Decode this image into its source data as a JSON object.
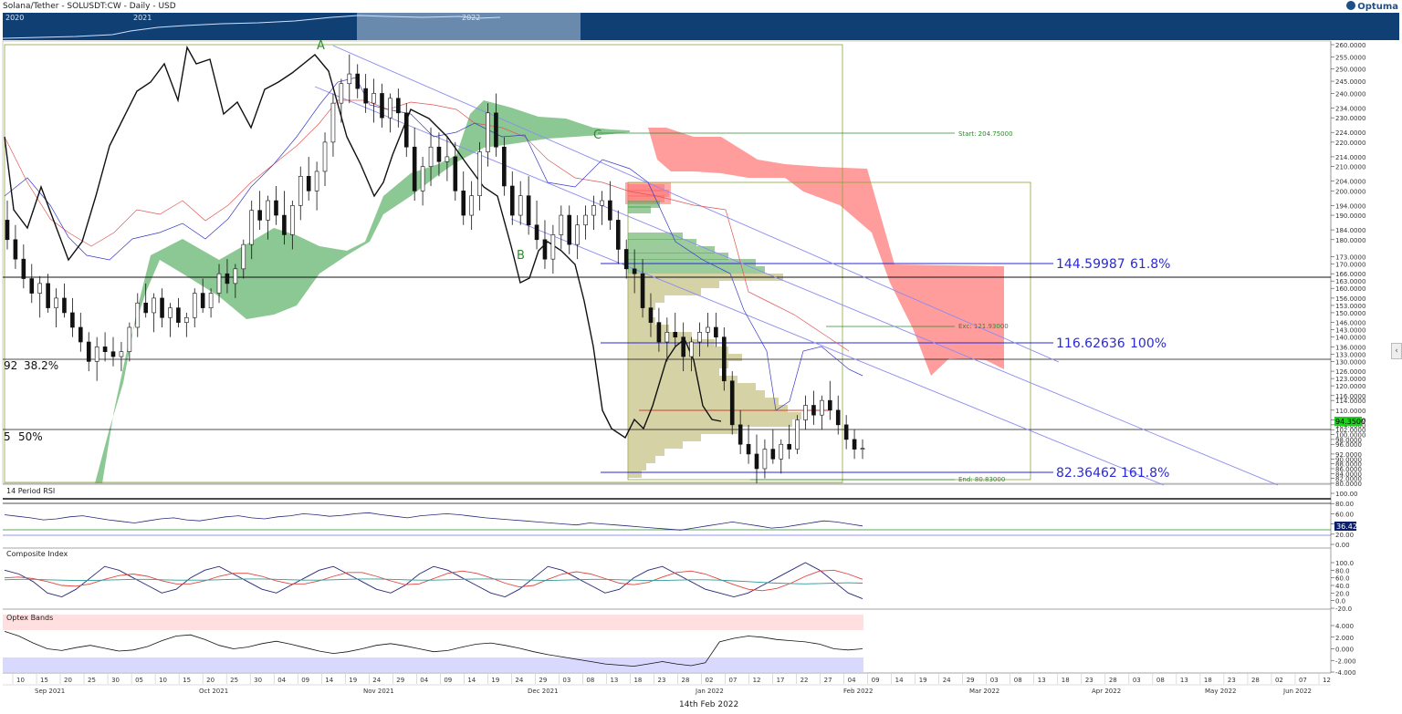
{
  "header": {
    "title": "Solana/Tether - SOLUSDT:CW - Daily - USD",
    "brand": "Optuma"
  },
  "navigator": {
    "years": [
      "2020",
      "2021",
      "2022"
    ]
  },
  "chart_data": [
    {
      "type": "candlestick",
      "title": "Solana/Tether - SOLUSDT:CW - Daily - USD",
      "ylim": [
        80,
        260
      ],
      "price_ticks": [
        260,
        255,
        250,
        245,
        240,
        234,
        230,
        224,
        220,
        214,
        210,
        204,
        200,
        194,
        190,
        184,
        180,
        173,
        170,
        166,
        163,
        160,
        156,
        153,
        150,
        146,
        143,
        140,
        136,
        133,
        130,
        126,
        123,
        120,
        116,
        114,
        110,
        106,
        104,
        102,
        100,
        98,
        96,
        92,
        90,
        88,
        86,
        84,
        82,
        80
      ],
      "last_price": "94.3500",
      "pivot_labels": [
        "A",
        "B",
        "C"
      ],
      "fib_levels": [
        {
          "price": "144.59987",
          "ratio": "61.8%"
        },
        {
          "price": "116.62636",
          "ratio": "100%"
        },
        {
          "price": "82.36462",
          "ratio": "161.8%"
        }
      ],
      "partial_levels": [
        {
          "price": "92",
          "ratio": "38.2%"
        },
        {
          "price": "5",
          "ratio": "50%"
        }
      ],
      "annotations": {
        "start": "Start: 204.75000",
        "exc": "Exc: 121.93000",
        "end": "End: 80.83000"
      },
      "candles": [
        [
          188,
          196,
          176,
          180
        ],
        [
          180,
          186,
          168,
          172
        ],
        [
          172,
          178,
          160,
          164
        ],
        [
          164,
          170,
          154,
          158
        ],
        [
          158,
          165,
          148,
          162
        ],
        [
          162,
          166,
          150,
          152
        ],
        [
          152,
          160,
          144,
          156
        ],
        [
          156,
          162,
          148,
          150
        ],
        [
          150,
          156,
          140,
          144
        ],
        [
          144,
          150,
          134,
          138
        ],
        [
          138,
          142,
          126,
          130
        ],
        [
          130,
          140,
          122,
          136
        ],
        [
          136,
          142,
          130,
          134
        ],
        [
          134,
          140,
          128,
          132
        ],
        [
          132,
          138,
          126,
          134
        ],
        [
          134,
          146,
          130,
          144
        ],
        [
          144,
          158,
          140,
          154
        ],
        [
          154,
          162,
          148,
          150
        ],
        [
          150,
          158,
          142,
          156
        ],
        [
          156,
          160,
          144,
          148
        ],
        [
          148,
          154,
          140,
          152
        ],
        [
          152,
          156,
          144,
          146
        ],
        [
          146,
          150,
          140,
          148
        ],
        [
          148,
          160,
          144,
          158
        ],
        [
          158,
          164,
          150,
          152
        ],
        [
          152,
          160,
          148,
          158
        ],
        [
          158,
          170,
          154,
          166
        ],
        [
          166,
          172,
          158,
          162
        ],
        [
          162,
          170,
          156,
          168
        ],
        [
          168,
          180,
          164,
          178
        ],
        [
          178,
          196,
          172,
          192
        ],
        [
          192,
          200,
          184,
          188
        ],
        [
          188,
          198,
          180,
          196
        ],
        [
          196,
          202,
          186,
          190
        ],
        [
          190,
          200,
          178,
          182
        ],
        [
          182,
          196,
          176,
          194
        ],
        [
          194,
          210,
          188,
          206
        ],
        [
          206,
          214,
          196,
          200
        ],
        [
          200,
          212,
          192,
          208
        ],
        [
          208,
          224,
          202,
          220
        ],
        [
          220,
          240,
          214,
          236
        ],
        [
          236,
          246,
          228,
          244
        ],
        [
          244,
          256,
          236,
          248
        ],
        [
          248,
          252,
          238,
          242
        ],
        [
          242,
          248,
          232,
          236
        ],
        [
          236,
          246,
          228,
          240
        ],
        [
          240,
          244,
          226,
          230
        ],
        [
          230,
          240,
          224,
          238
        ],
        [
          238,
          242,
          226,
          232
        ],
        [
          232,
          236,
          214,
          218
        ],
        [
          218,
          226,
          196,
          200
        ],
        [
          200,
          214,
          194,
          210
        ],
        [
          210,
          226,
          202,
          218
        ],
        [
          218,
          224,
          206,
          212
        ],
        [
          212,
          222,
          204,
          214
        ],
        [
          214,
          220,
          196,
          200
        ],
        [
          200,
          208,
          186,
          190
        ],
        [
          190,
          204,
          184,
          198
        ],
        [
          198,
          220,
          192,
          216
        ],
        [
          216,
          236,
          210,
          232
        ],
        [
          232,
          240,
          214,
          218
        ],
        [
          218,
          222,
          198,
          202
        ],
        [
          202,
          208,
          186,
          190
        ],
        [
          190,
          204,
          186,
          198
        ],
        [
          198,
          206,
          182,
          186
        ],
        [
          186,
          196,
          176,
          180
        ],
        [
          180,
          188,
          168,
          172
        ],
        [
          172,
          186,
          166,
          182
        ],
        [
          182,
          194,
          176,
          190
        ],
        [
          190,
          194,
          174,
          178
        ],
        [
          178,
          190,
          172,
          186
        ],
        [
          186,
          194,
          180,
          190
        ],
        [
          190,
          198,
          184,
          194
        ],
        [
          194,
          200,
          186,
          196
        ],
        [
          196,
          204,
          184,
          188
        ],
        [
          188,
          192,
          170,
          176
        ],
        [
          176,
          180,
          164,
          168
        ],
        [
          168,
          176,
          158,
          166
        ],
        [
          166,
          172,
          148,
          152
        ],
        [
          152,
          158,
          140,
          146
        ],
        [
          146,
          152,
          134,
          138
        ],
        [
          138,
          148,
          130,
          142
        ],
        [
          142,
          150,
          136,
          140
        ],
        [
          140,
          146,
          126,
          132
        ],
        [
          132,
          140,
          126,
          138
        ],
        [
          138,
          146,
          132,
          142
        ],
        [
          142,
          150,
          136,
          144
        ],
        [
          144,
          150,
          136,
          140
        ],
        [
          140,
          144,
          118,
          122
        ],
        [
          122,
          126,
          100,
          104
        ],
        [
          104,
          110,
          92,
          96
        ],
        [
          96,
          104,
          88,
          92
        ],
        [
          92,
          100,
          80,
          86
        ],
        [
          86,
          98,
          82,
          94
        ],
        [
          94,
          102,
          88,
          90
        ],
        [
          90,
          98,
          84,
          96
        ],
        [
          96,
          104,
          90,
          94
        ],
        [
          94,
          108,
          92,
          106
        ],
        [
          106,
          116,
          102,
          112
        ],
        [
          112,
          118,
          104,
          108
        ],
        [
          108,
          116,
          102,
          114
        ],
        [
          114,
          122,
          106,
          110
        ],
        [
          110,
          116,
          100,
          104
        ],
        [
          104,
          108,
          94,
          98
        ],
        [
          98,
          102,
          90,
          94
        ],
        [
          94,
          98,
          90,
          94.35
        ]
      ]
    },
    {
      "type": "line",
      "title": "14 Period RSI",
      "ylim": [
        0,
        100
      ],
      "ticks": [
        "100.00",
        "80.00",
        "60.00",
        "40.00",
        "20.00",
        "0.00"
      ],
      "last_value": "36.42",
      "values": [
        58,
        55,
        52,
        48,
        50,
        54,
        56,
        52,
        48,
        45,
        42,
        46,
        50,
        52,
        48,
        46,
        50,
        54,
        56,
        52,
        50,
        54,
        56,
        60,
        58,
        55,
        57,
        60,
        62,
        58,
        55,
        52,
        56,
        58,
        60,
        58,
        55,
        52,
        50,
        48,
        46,
        44,
        42,
        40,
        38,
        42,
        40,
        38,
        36,
        34,
        32,
        30,
        28,
        32,
        36,
        40,
        44,
        40,
        36,
        32,
        34,
        38,
        42,
        46,
        44,
        40,
        36
      ]
    },
    {
      "type": "line",
      "title": "Composite Index",
      "ylim": [
        -20,
        100
      ],
      "ticks": [
        "100.0",
        "80.0",
        "60.0",
        "40.0",
        "20.0",
        "0.0",
        "-20.0"
      ],
      "series": [
        {
          "values": [
            80,
            70,
            50,
            20,
            10,
            30,
            60,
            90,
            80,
            60,
            40,
            20,
            30,
            60,
            80,
            90,
            70,
            50,
            30,
            20,
            40,
            60,
            80,
            90,
            70,
            50,
            30,
            20,
            40,
            70,
            90,
            80,
            60,
            40,
            20,
            10,
            30,
            60,
            90,
            80,
            60,
            40,
            20,
            30,
            60,
            80,
            90,
            70,
            50,
            30,
            20,
            10,
            20,
            40,
            60,
            80,
            100,
            80,
            50,
            20,
            5
          ]
        },
        {
          "values": [
            60,
            62,
            58,
            50,
            40,
            38,
            44,
            56,
            66,
            70,
            64,
            52,
            44,
            44,
            52,
            64,
            72,
            72,
            64,
            52,
            44,
            44,
            52,
            64,
            74,
            74,
            64,
            52,
            42,
            44,
            58,
            72,
            78,
            72,
            60,
            46,
            36,
            40,
            56,
            70,
            76,
            70,
            58,
            46,
            42,
            48,
            62,
            74,
            78,
            70,
            56,
            42,
            30,
            26,
            32,
            46,
            64,
            78,
            80,
            70,
            56
          ]
        },
        {
          "values": [
            55,
            56,
            56,
            55,
            54,
            53,
            53,
            54,
            55,
            56,
            56,
            55,
            54,
            54,
            54,
            55,
            56,
            57,
            57,
            56,
            55,
            54,
            54,
            55,
            56,
            57,
            57,
            56,
            55,
            54,
            54,
            55,
            56,
            57,
            57,
            56,
            55,
            54,
            53,
            54,
            55,
            56,
            56,
            55,
            54,
            53,
            53,
            54,
            55,
            55,
            54,
            52,
            50,
            48,
            46,
            45,
            44,
            45,
            46,
            47,
            46
          ]
        }
      ]
    },
    {
      "type": "line",
      "title": "Optex Bands",
      "ylim": [
        -4,
        4
      ],
      "ticks": [
        "4.000",
        "2.000",
        "0.000",
        "-2.000",
        "-4.000"
      ],
      "values": [
        3.0,
        2.2,
        1.0,
        0.0,
        -0.3,
        0.2,
        0.6,
        0.1,
        -0.4,
        -0.2,
        0.4,
        1.4,
        2.2,
        2.4,
        1.6,
        0.6,
        0.0,
        0.3,
        0.9,
        1.3,
        0.8,
        0.2,
        -0.4,
        -0.8,
        -0.5,
        0.0,
        0.6,
        0.9,
        0.5,
        0.0,
        -0.5,
        -0.3,
        0.3,
        0.8,
        1.0,
        0.6,
        0.1,
        -0.5,
        -1.0,
        -1.4,
        -1.8,
        -2.2,
        -2.6,
        -2.8,
        -3.0,
        -2.6,
        -2.2,
        -2.6,
        -2.9,
        -2.4,
        1.2,
        1.8,
        2.2,
        2.0,
        1.6,
        1.4,
        1.2,
        0.8,
        0.0,
        -0.2,
        0.0
      ]
    }
  ],
  "x_axis": {
    "day_ticks": [
      "10",
      "15",
      "20",
      "25",
      "30",
      "05",
      "10",
      "15",
      "20",
      "25",
      "30",
      "04",
      "09",
      "14",
      "19",
      "24",
      "29",
      "04",
      "09",
      "14",
      "19",
      "24",
      "29",
      "03",
      "08",
      "13",
      "18",
      "23",
      "28",
      "02",
      "07",
      "12",
      "17",
      "22",
      "27",
      "04",
      "09",
      "14",
      "19",
      "24",
      "29",
      "03",
      "08",
      "13",
      "18",
      "23",
      "28",
      "03",
      "08",
      "13",
      "18",
      "23",
      "28",
      "02",
      "07",
      "12"
    ],
    "months": [
      "Sep 2021",
      "Oct 2021",
      "Nov 2021",
      "Dec 2021",
      "Jan 2022",
      "Feb 2022",
      "Mar 2022",
      "Apr 2022",
      "May 2022",
      "Jun 2022"
    ],
    "footer_date": "14th Feb 2022"
  },
  "colors": {
    "navigator": "#0f3f73",
    "cloud_bull": "#2e9a3a",
    "cloud_bear": "#ff5a5a",
    "fib_line": "#2a2ad8",
    "channel": "#8c8cf0",
    "rsi_line": "#27277a",
    "price_tag": "#1fcf1f",
    "volume_profile": "#b9b46a"
  }
}
